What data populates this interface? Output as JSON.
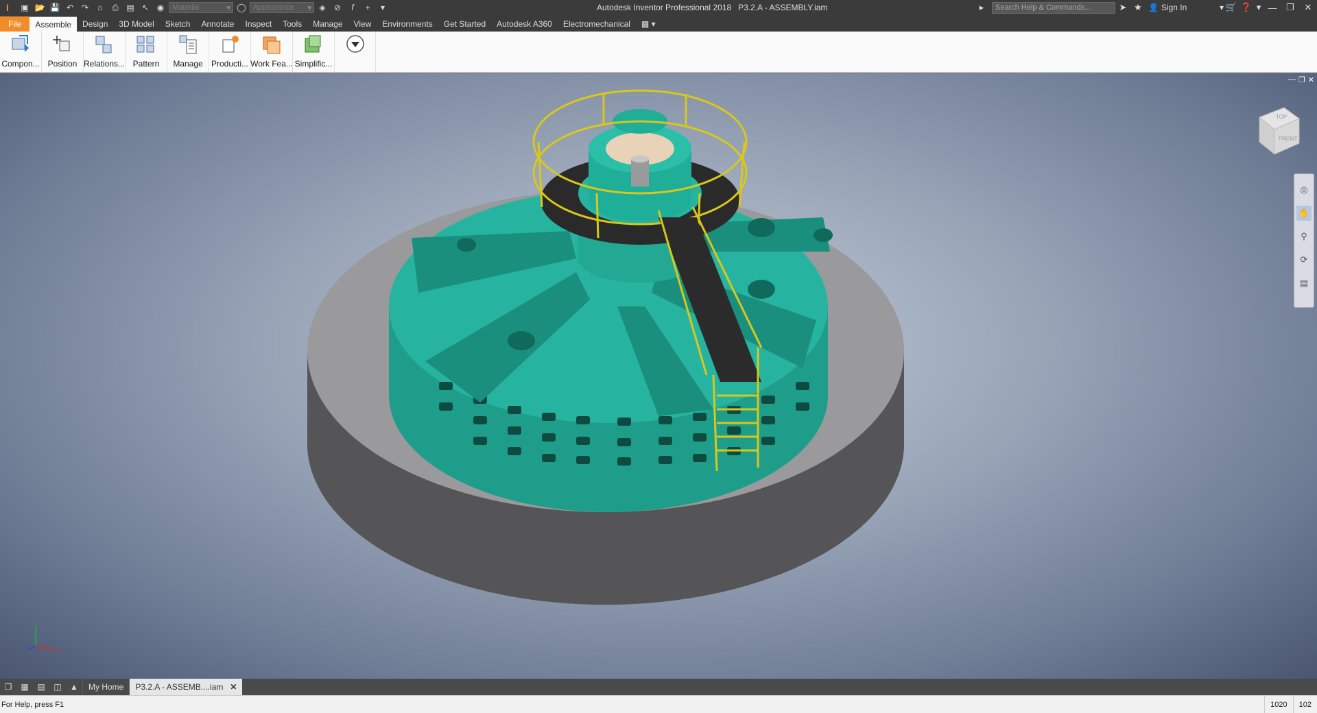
{
  "titlebar": {
    "app_title": "Autodesk Inventor Professional 2018",
    "document_title": "P3.2.A - ASSEMBLY.iam",
    "material_placeholder": "Material",
    "appearance_placeholder": "Appearance",
    "search_placeholder": "Search Help & Commands...",
    "sign_in": "Sign In"
  },
  "ribbon_tabs": [
    "File",
    "Assemble",
    "Design",
    "3D Model",
    "Sketch",
    "Annotate",
    "Inspect",
    "Tools",
    "Manage",
    "View",
    "Environments",
    "Get Started",
    "Autodesk A360",
    "Electromechanical"
  ],
  "active_tab": "Assemble",
  "ribbon_buttons": [
    {
      "label": "Compon...",
      "icon": "component-icon"
    },
    {
      "label": "Position",
      "icon": "position-icon"
    },
    {
      "label": "Relations...",
      "icon": "relationships-icon"
    },
    {
      "label": "Pattern",
      "icon": "pattern-icon"
    },
    {
      "label": "Manage",
      "icon": "manage-icon"
    },
    {
      "label": "Producti...",
      "icon": "productivity-icon"
    },
    {
      "label": "Work Fea...",
      "icon": "work-features-icon"
    },
    {
      "label": "Simplific...",
      "icon": "simplification-icon"
    }
  ],
  "viewcube": {
    "top": "TOP",
    "front": "FRONT"
  },
  "triad": {
    "x": "X"
  },
  "doc_tabs": {
    "home": "My Home",
    "active": "P3.2.A - ASSEMB....iam"
  },
  "status": {
    "help": "For Help, press F1",
    "count1": "1020",
    "count2": "102"
  },
  "colors": {
    "model_teal": "#2bbfa8",
    "accent_orange": "#f28c28",
    "railing_yellow": "#d8c81a"
  }
}
